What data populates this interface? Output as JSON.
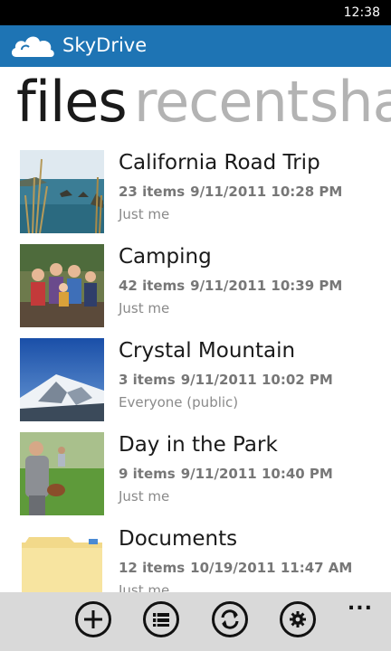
{
  "status": {
    "time": "12:38"
  },
  "app": {
    "title": "SkyDrive",
    "brand_color": "#1e74b4"
  },
  "pivot": {
    "items": [
      "files",
      "recent",
      "sha"
    ],
    "active": "files"
  },
  "folders": [
    {
      "name": "California Road Trip",
      "count": "23 items",
      "date": "9/11/2011 10:28 PM",
      "sharing": "Just me",
      "thumb": "coast-photo"
    },
    {
      "name": "Camping",
      "count": "42 items",
      "date": "9/11/2011 10:39 PM",
      "sharing": "Just me",
      "thumb": "family-photo"
    },
    {
      "name": "Crystal Mountain",
      "count": "3 items",
      "date": "9/11/2011 10:02 PM",
      "sharing": "Everyone (public)",
      "thumb": "mountain-photo"
    },
    {
      "name": "Day in the Park",
      "count": "9 items",
      "date": "9/11/2011 10:40 PM",
      "sharing": "Just me",
      "thumb": "park-photo"
    },
    {
      "name": "Documents",
      "count": "12 items",
      "date": "10/19/2011 11:47 AM",
      "sharing": "Just me",
      "thumb": "folder-icon"
    }
  ],
  "appbar": {
    "buttons": [
      "add-icon",
      "select-icon",
      "sync-icon",
      "settings-icon"
    ],
    "more": "..."
  }
}
